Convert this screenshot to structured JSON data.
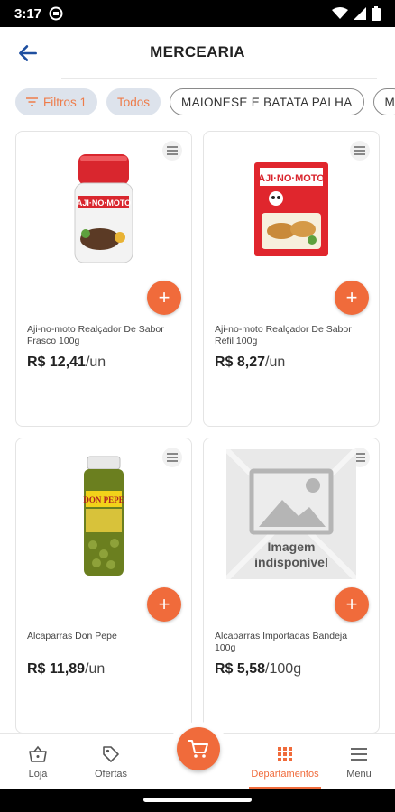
{
  "status_bar": {
    "time": "3:17"
  },
  "header": {
    "title": "MERCEARIA"
  },
  "chips": [
    {
      "label": "Filtros 1",
      "style": "filled"
    },
    {
      "label": "Todos",
      "style": "filled"
    },
    {
      "label": "MAIONESE E BATATA PALHA",
      "style": "outline"
    },
    {
      "label": "M",
      "style": "outline"
    }
  ],
  "products": [
    {
      "name": "Aji-no-moto Realçador De Sabor Frasco 100g",
      "price": "R$ 12,41",
      "unit": "/un",
      "image": "ajinomoto-bottle"
    },
    {
      "name": "Aji-no-moto Realçador De Sabor Refil 100g",
      "price": "R$ 8,27",
      "unit": "/un",
      "image": "ajinomoto-box"
    },
    {
      "name": "Alcaparras Don Pepe",
      "price": "R$ 11,89",
      "unit": "/un",
      "image": "capers-jar"
    },
    {
      "name": "Alcaparras Importadas Bandeja 100g",
      "price": "R$ 5,58",
      "unit": "/100g",
      "image": "placeholder",
      "placeholder_text_1": "Imagem",
      "placeholder_text_2": "indisponível"
    }
  ],
  "bottom_nav": {
    "items": [
      {
        "label": "Loja",
        "icon": "basket-icon"
      },
      {
        "label": "Ofertas",
        "icon": "tag-icon"
      },
      {
        "label": "Departamentos",
        "icon": "grid-icon",
        "active": true
      },
      {
        "label": "Menu",
        "icon": "menu-icon"
      }
    ],
    "cart_icon": "cart-icon"
  },
  "colors": {
    "accent": "#f06b3b",
    "chip_bg": "#dde3ec",
    "back_arrow": "#1e4fa0"
  }
}
